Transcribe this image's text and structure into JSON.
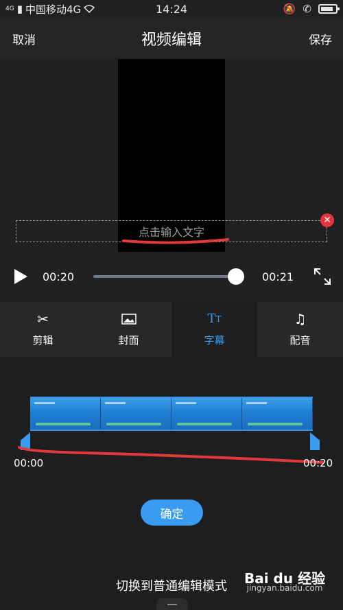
{
  "status_bar": {
    "signal_text": "4G",
    "carrier": "中国移动4G",
    "time": "14:24"
  },
  "header": {
    "cancel_label": "取消",
    "title": "视频编辑",
    "save_label": "保存"
  },
  "preview": {
    "text_placeholder": "点击输入文字"
  },
  "player": {
    "current_time": "00:20",
    "total_time": "00:21",
    "progress": 0.98
  },
  "tabs": [
    {
      "label": "剪辑",
      "icon": "scissors-icon"
    },
    {
      "label": "封面",
      "icon": "image-icon"
    },
    {
      "label": "字幕",
      "icon": "text-size-icon",
      "active": true
    },
    {
      "label": "配音",
      "icon": "music-note-icon"
    }
  ],
  "timeline": {
    "start_time": "00:00",
    "end_time": "00:20"
  },
  "actions": {
    "confirm_label": "确定",
    "switch_mode_label": "切换到普通编辑模式"
  },
  "watermark": {
    "brand": "Bai du 经验",
    "url": "jingyan.baidu.com"
  },
  "colors": {
    "accent": "#3a9cf0",
    "close": "#e6343a",
    "annotation_red": "#e23a3a"
  }
}
